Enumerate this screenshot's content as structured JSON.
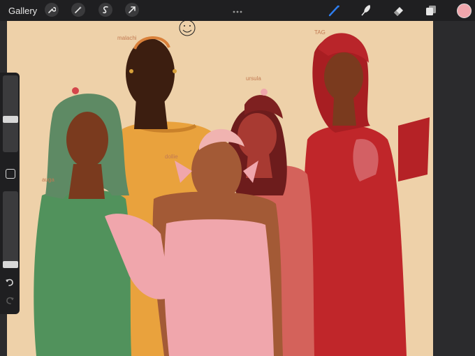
{
  "toolbar": {
    "gallery_label": "Gallery",
    "left_tools": [
      "wrench-icon",
      "magic-wand-icon",
      "selection-icon",
      "transform-arrow-icon"
    ],
    "right_tools": [
      "brush-icon",
      "smudge-icon",
      "eraser-icon",
      "layers-icon"
    ],
    "active_tool": "brush-icon",
    "current_color": "#f0a6ac"
  },
  "canvas": {
    "background_color": "#eed1a9",
    "annotations": {
      "top_center": "malachi",
      "right": "TAG",
      "pink_char": "ursula",
      "left_char": "auga",
      "center_char": "dollie"
    }
  },
  "colors": {
    "green_dress": "#51925c",
    "yellow_shirt": "#e9a23d",
    "pink_dress": "#f0a6ac",
    "rose_dress": "#d4625b",
    "red_dress": "#c0262a",
    "skin_dark": "#3c1e10",
    "skin_brown": "#7a3a1e",
    "skin_tan": "#a35a36"
  }
}
